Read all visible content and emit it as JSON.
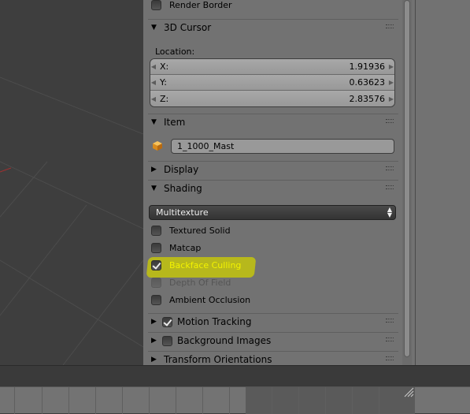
{
  "render_border": {
    "label": "Render Border"
  },
  "cursor_section": {
    "title": "3D Cursor",
    "location_label": "Location:",
    "x": {
      "label": "X:",
      "value": "1.91936"
    },
    "y": {
      "label": "Y:",
      "value": "0.63623"
    },
    "z": {
      "label": "Z:",
      "value": "2.83576"
    }
  },
  "item_section": {
    "title": "Item",
    "object_name": "1_1000_Mast"
  },
  "display_section": {
    "title": "Display"
  },
  "shading_section": {
    "title": "Shading",
    "mode": "Multitexture",
    "options": [
      {
        "label": "Textured Solid",
        "checked": false,
        "enabled": true
      },
      {
        "label": "Matcap",
        "checked": false,
        "enabled": true
      },
      {
        "label": "Backface Culling",
        "checked": true,
        "enabled": true
      },
      {
        "label": "Depth Of Field",
        "checked": false,
        "enabled": false
      },
      {
        "label": "Ambient Occlusion",
        "checked": false,
        "enabled": true
      }
    ]
  },
  "motion_tracking": {
    "title": "Motion Tracking",
    "checked": true
  },
  "background_images": {
    "title": "Background Images",
    "checked": false
  },
  "transform_orientations": {
    "title": "Transform Orientations"
  },
  "colors": {
    "highlight": "#e8e800",
    "highlight_marker": "#b7b81c"
  }
}
